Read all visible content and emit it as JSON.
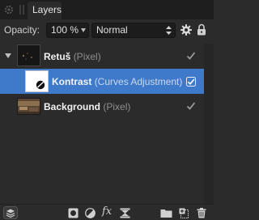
{
  "panel": {
    "tab_label": "Layers",
    "tab_icons": [
      "settings-icon",
      "drag-handle-icon"
    ]
  },
  "options": {
    "opacity_label": "Opacity:",
    "opacity_value": "100 %",
    "blend_mode": "Normal",
    "icons": [
      "gear-icon",
      "lock-icon"
    ]
  },
  "layers": [
    {
      "name": "Retuš",
      "kind": "(Pixel)",
      "visible": true,
      "expanded": true,
      "selected": false
    },
    {
      "name": "Kontrast",
      "kind": "(Curves Adjustment)",
      "visible": true,
      "selected": true
    },
    {
      "name": "Background",
      "kind": "(Pixel)",
      "visible": true,
      "selected": false
    }
  ],
  "toolbar": {
    "icons": [
      "layer-studio-icon",
      "mask-icon",
      "adjustment-icon",
      "fx-icon",
      "live-filter-icon",
      "folder-icon",
      "add-layer-icon",
      "delete-icon"
    ],
    "fx_label": "fx"
  },
  "colors": {
    "selection": "#3f79c9",
    "panel_bg": "#2b2b2b"
  }
}
